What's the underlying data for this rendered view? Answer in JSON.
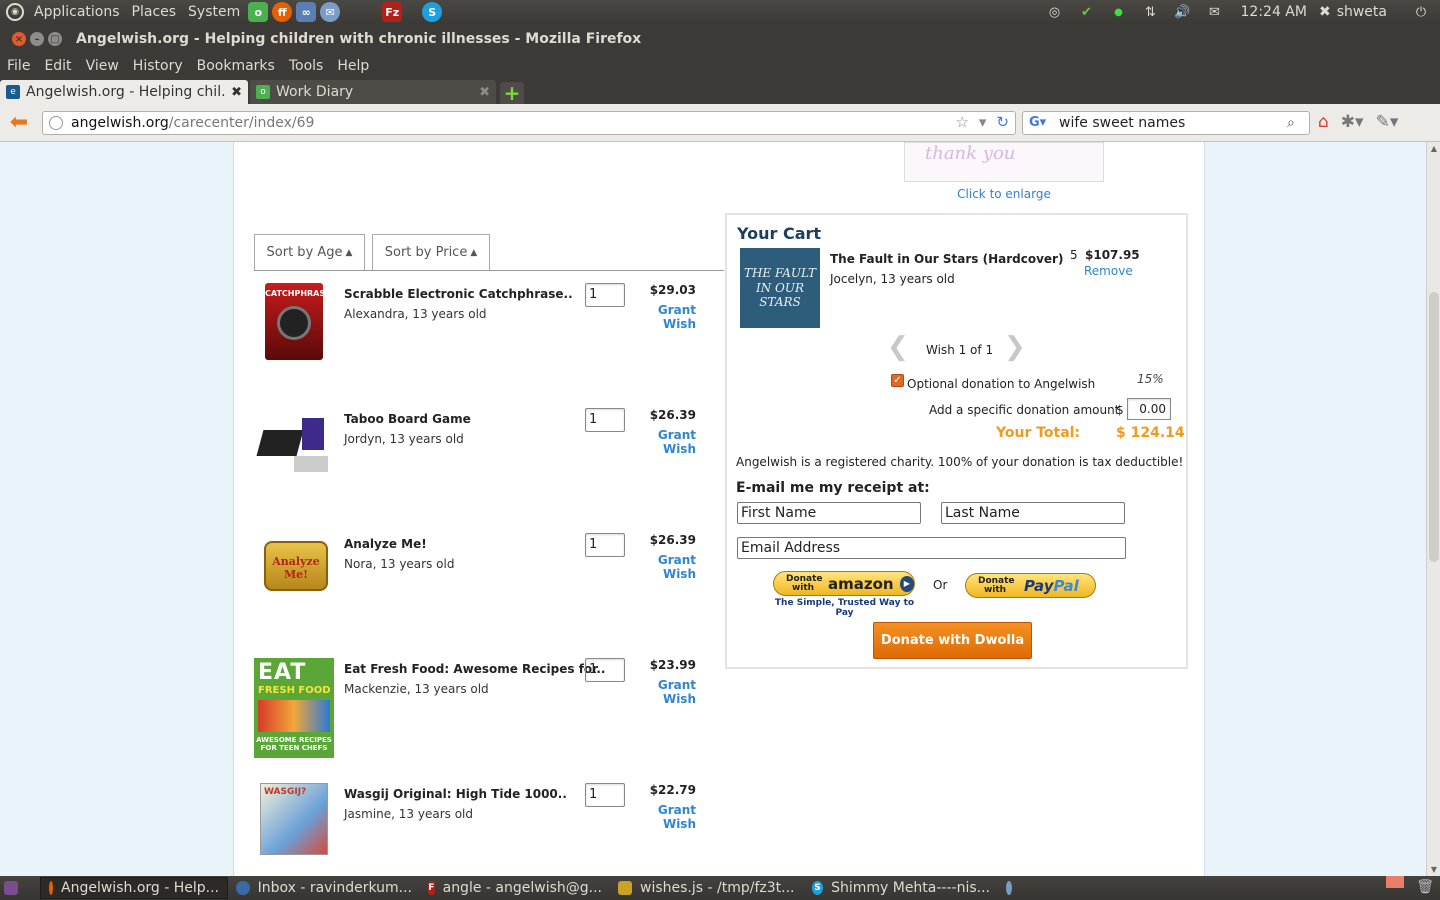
{
  "top_panel": {
    "menus": [
      "Applications",
      "Places",
      "System"
    ],
    "clock": "12:24 AM",
    "user": "shweta"
  },
  "window": {
    "title": "Angelwish.org - Helping children with chronic illnesses - Mozilla Firefox"
  },
  "menubar": [
    "File",
    "Edit",
    "View",
    "History",
    "Bookmarks",
    "Tools",
    "Help"
  ],
  "tabs": [
    {
      "label": "Angelwish.org - Helping chil...",
      "active": true
    },
    {
      "label": "Work Diary",
      "active": false
    }
  ],
  "navbar": {
    "url_domain": "angelwish.org",
    "url_path": "/carecenter/index/69",
    "search_value": "wife sweet names"
  },
  "page": {
    "thumb_text": "thank you",
    "enlarge_label": "Click to enlarge",
    "sort_age": "Sort by Age",
    "sort_price": "Sort by Price",
    "wishes": [
      {
        "name": "Scrabble Electronic Catchphrase..",
        "who": "Alexandra, 13 years old",
        "qty": "1",
        "price": "$29.03",
        "action": "Grant Wish"
      },
      {
        "name": "Taboo Board Game",
        "who": "Jordyn, 13 years old",
        "qty": "1",
        "price": "$26.39",
        "action": "Grant Wish"
      },
      {
        "name": "Analyze Me!",
        "who": "Nora, 13 years old",
        "qty": "1",
        "price": "$26.39",
        "action": "Grant Wish"
      },
      {
        "name": "Eat Fresh Food: Awesome Recipes for..",
        "who": "Mackenzie, 13 years old",
        "qty": "1",
        "price": "$23.99",
        "action": "Grant Wish"
      },
      {
        "name": "Wasgij Original: High Tide 1000..",
        "who": "Jasmine, 13 years old",
        "qty": "1",
        "price": "$22.79",
        "action": "Grant Wish"
      }
    ],
    "cart": {
      "title": "Your Cart",
      "book_cover_text": "THE FAULT IN OUR STARS",
      "item_name": "The Fault in Our Stars (Hardcover)",
      "item_who": "Jocelyn, 13 years old",
      "item_qty": "5",
      "item_price": "$107.95",
      "remove_label": "Remove",
      "wish_count": "Wish 1 of 1",
      "optional_label": "Optional donation to Angelwish",
      "optional_checked": true,
      "optional_pct": "15%",
      "add_amount_label": "Add a specific donation amount",
      "currency": "$",
      "amount_value": "0.00",
      "total_label": "Your Total:",
      "total_value": "$ 124.14",
      "charity_note": "Angelwish is a registered charity. 100% of your donation is tax deductible!",
      "receipt_label": "E-mail me my receipt at:",
      "first_name_placeholder": "First Name",
      "last_name_placeholder": "Last Name",
      "email_placeholder": "Email Address",
      "amazon_small": "Donate with",
      "amazon_brand": "amazon",
      "amazon_tagline": "The Simple, Trusted Way to Pay",
      "or_label": "Or",
      "paypal_small": "Donate with",
      "paypal_brand_a": "Pay",
      "paypal_brand_b": "Pal",
      "dwolla_label": "Donate with Dwolla"
    }
  },
  "taskbar": [
    "Angelwish.org - Help...",
    "Inbox - ravinderkum...",
    "angle - angelwish@g...",
    "wishes.js - /tmp/fz3t...",
    "Shimmy Mehta----nis..."
  ],
  "colors": {
    "link": "#2f85d0",
    "total": "#f29a1b",
    "dwolla": "#e8790f"
  }
}
